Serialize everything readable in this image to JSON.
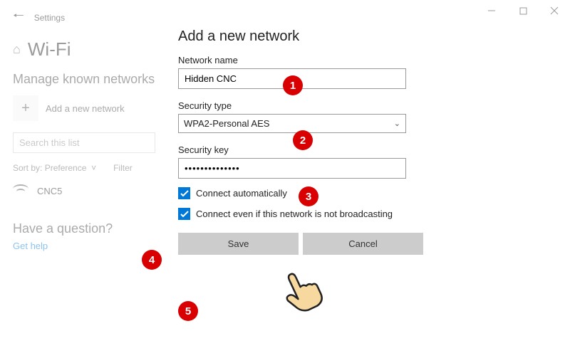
{
  "header": {
    "app_title": "Settings",
    "page_title": "Wi-Fi",
    "subheading": "Manage known networks"
  },
  "sidebar": {
    "add_network_label": "Add a new network",
    "search_placeholder": "Search this list",
    "sort_label": "Sort by:",
    "sort_value": "Preference",
    "filter_label": "Filter"
  },
  "networks": [
    {
      "name": "CNC5"
    }
  ],
  "help": {
    "question_heading": "Have a question?",
    "link": "Get help"
  },
  "modal": {
    "title": "Add a new network",
    "fields": {
      "network_name_label": "Network name",
      "network_name_value": "Hidden CNC",
      "security_type_label": "Security type",
      "security_type_value": "WPA2-Personal AES",
      "security_key_label": "Security key",
      "security_key_value": "••••••••••••••"
    },
    "checkboxes": {
      "connect_auto": "Connect automatically",
      "connect_hidden": "Connect even if this network is not broadcasting"
    },
    "buttons": {
      "save": "Save",
      "cancel": "Cancel"
    }
  },
  "annotations": {
    "a1": "1",
    "a2": "2",
    "a3": "3",
    "a4": "4",
    "a5": "5"
  }
}
